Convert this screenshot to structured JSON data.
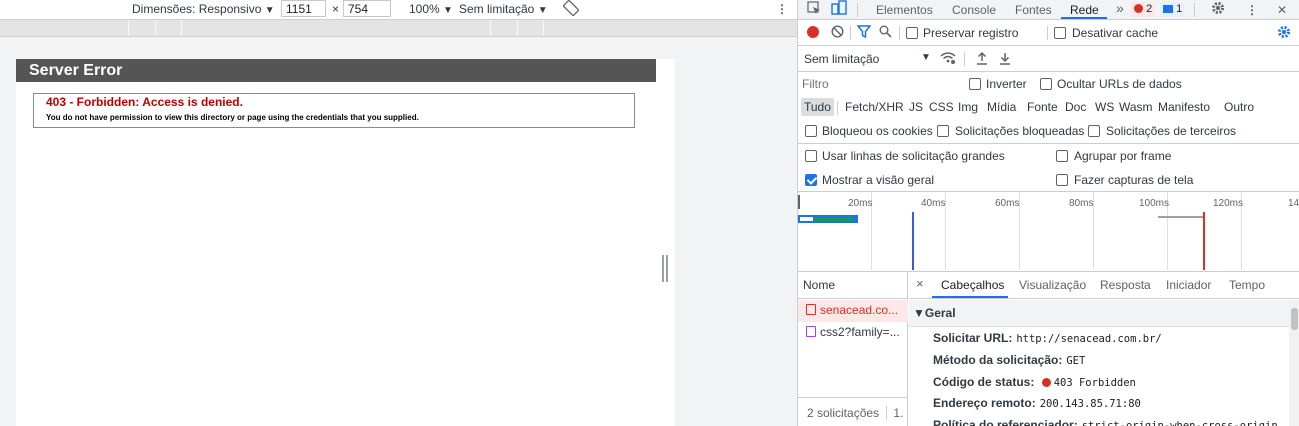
{
  "device_toolbar": {
    "dimensions_label": "Dimensões: Responsivo",
    "width_value": "1151",
    "times": "×",
    "height_value": "754",
    "zoom_label": "100%",
    "throttle_label": "Sem limitação",
    "dropdown_arrow": "▼",
    "more": "⋮"
  },
  "page": {
    "error_title": "Server Error",
    "error_heading": "403 - Forbidden: Access is denied.",
    "error_message": "You do not have permission to view this directory or page using the credentials that you supplied."
  },
  "devtools": {
    "tabs": [
      "Elementos",
      "Console",
      "Fontes",
      "Rede"
    ],
    "more_tabs": "»",
    "error_count": "2",
    "message_count": "1",
    "close": "✕",
    "toolbar": {
      "preserve_log": "Preservar registro",
      "disable_cache": "Desativar cache",
      "throttle": "Sem limitação"
    },
    "filter": {
      "placeholder": "Filtro",
      "invert": "Inverter",
      "hide_data_urls": "Ocultar URLs de dados"
    },
    "type_filters": [
      "Tudo",
      "Fetch/XHR",
      "JS",
      "CSS",
      "Img",
      "Mídia",
      "Fonte",
      "Doc",
      "WS",
      "Wasm",
      "Manifesto",
      "Outro"
    ],
    "blocked": {
      "blocked_cookies": "Bloqueou os cookies",
      "blocked_requests": "Solicitações bloqueadas",
      "third_party": "Solicitações de terceiros"
    },
    "options": {
      "large_rows": "Usar linhas de solicitação grandes",
      "group_by_frame": "Agrupar por frame",
      "show_overview": "Mostrar a visão geral",
      "capture_screenshots": "Fazer capturas de tela",
      "show_overview_checked": true
    },
    "timeline_ticks": [
      "20ms",
      "40ms",
      "60ms",
      "80ms",
      "100ms",
      "120ms",
      "14"
    ],
    "requests_header": "Nome",
    "requests": [
      {
        "name": "senacead.co...",
        "selected": true
      },
      {
        "name": "css2?family=...",
        "selected": false
      }
    ],
    "requests_status": "2 solicitações",
    "requests_status_more": "1.",
    "detail_tabs": [
      "Cabeçalhos",
      "Visualização",
      "Resposta",
      "Iniciador",
      "Tempo"
    ],
    "section_title": "▼Geral",
    "general": {
      "url_label": "Solicitar URL:",
      "url_value": "http://senacead.com.br/",
      "method_label": "Método da solicitação:",
      "method_value": "GET",
      "status_label": "Código de status:",
      "status_value": "403 Forbidden",
      "remote_label": "Endereço remoto:",
      "remote_value": "200.143.85.71:80",
      "referrer_label": "Política do referenciador:",
      "referrer_value": "strict-origin-when-cross-origin"
    },
    "colors": {
      "accent": "#1a73e8",
      "record": "#d93025",
      "error_text": "#c00000",
      "title_bar": "#555555"
    }
  }
}
